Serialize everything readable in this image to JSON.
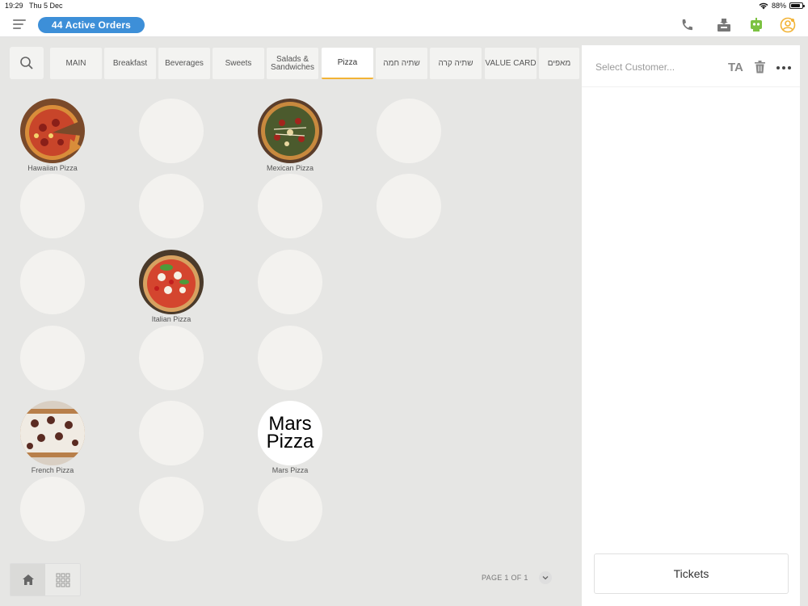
{
  "status_bar": {
    "time": "19:29",
    "date": "Thu 5 Dec",
    "battery": "88%",
    "battery_level": 0.88
  },
  "header": {
    "active_orders": "44 Active Orders",
    "icons": [
      "menu-icon",
      "phone-icon",
      "cash-drawer-icon",
      "robot-icon",
      "user-circle-icon"
    ],
    "colors": {
      "pill": "#3d8fd8",
      "robot": "#7cc242",
      "user": "#f2b336"
    }
  },
  "categories": {
    "search_icon": "search-icon",
    "tabs": [
      {
        "label": "MAIN"
      },
      {
        "label": "Breakfast"
      },
      {
        "label": "Beverages"
      },
      {
        "label": "Sweets"
      },
      {
        "label": "Salads & Sandwiches"
      },
      {
        "label": "Pizza",
        "active": true
      },
      {
        "label": "שתיה חמה"
      },
      {
        "label": "שתיה קרה"
      },
      {
        "label": "VALUE CARD"
      },
      {
        "label": "מאפים"
      }
    ]
  },
  "products": [
    {
      "name": "Hawaiian Pizza"
    },
    {
      "name": "Mexican Pizza"
    },
    {
      "name": "Italian Pizza"
    },
    {
      "name": "French Pizza"
    },
    {
      "name": "Mars Pizza",
      "image_text": "Mars Pizza"
    }
  ],
  "pagination": {
    "label": "PAGE 1 OF 1"
  },
  "order_panel": {
    "customer_placeholder": "Select Customer...",
    "ta_label": "TA",
    "tickets_label": "Tickets"
  }
}
